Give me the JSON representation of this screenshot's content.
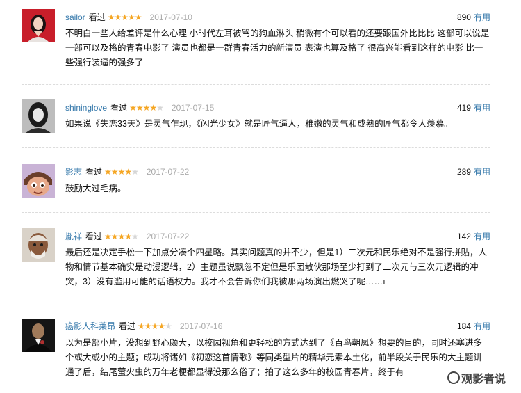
{
  "reviews": [
    {
      "user": "sailor",
      "watched": "看过",
      "rating": 5,
      "date": "2017-07-10",
      "votes": "890",
      "useful": "有用",
      "text": "不明白一些人给差评是什么心理 小时代左耳被骂的狗血淋头 稍微有个可以看的还要跟国外比比比 这部可以说是一部可以及格的青春电影了 演员也都是一群青春活力的新演员 表演也算及格了 很高兴能看到这样的电影 比一些强行装逼的强多了"
    },
    {
      "user": "shininglove",
      "watched": "看过",
      "rating": 4,
      "date": "2017-07-15",
      "votes": "419",
      "useful": "有用",
      "text": "如果说《失恋33天》是灵气乍现，《闪光少女》就是匠气逼人，稚嫩的灵气和成熟的匠气都令人羡慕。"
    },
    {
      "user": "影志",
      "watched": "看过",
      "rating": 4,
      "date": "2017-07-22",
      "votes": "289",
      "useful": "有用",
      "text": "鼓励大过毛病。"
    },
    {
      "user": "胤祥",
      "watched": "看过",
      "rating": 4,
      "date": "2017-07-22",
      "votes": "142",
      "useful": "有用",
      "text": "最后还是决定手松一下加点分凑个四星略。其实问题真的并不少，但是1）二次元和民乐绝对不是强行拼贴，人物和情节基本确实是动漫逻辑，2）主题虽说飘忽不定但是乐团散伙那场至少打到了二次元与三次元逻辑的冲突，3）没有滥用可能的话语权力。我才不会告诉你们我被那两场演出燃哭了呢……⊏"
    },
    {
      "user": "癌影人科莱昂",
      "watched": "看过",
      "rating": 4,
      "date": "2017-07-16",
      "votes": "184",
      "useful": "有用",
      "text": "以为是部小片，没想到野心颇大，以校园视角和更轻松的方式达到了《百鸟朝凤》想要的目的，同时还塞进多个或大或小的主题；成功将诸如《初恋这首情歌》等同类型片的精华元素本土化，前半段关于民乐的大主题讲通了后，结尾萤火虫的万年老梗都显得没那么俗了；拍了这么多年的校园青春片，终于有"
    }
  ],
  "watermark": "观影者说"
}
